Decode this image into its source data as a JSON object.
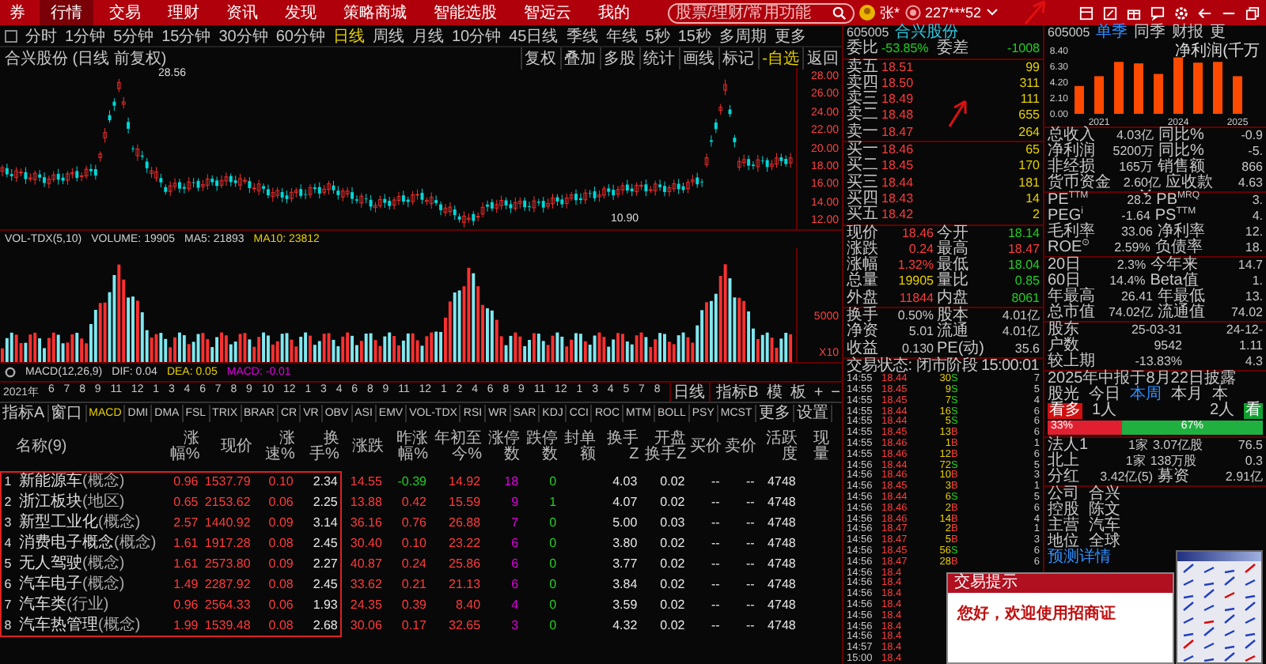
{
  "top_bar": {
    "logo": "券",
    "tabs": [
      {
        "label": "行情",
        "selected": true
      },
      {
        "label": "交易",
        "selected": false
      },
      {
        "label": "理财",
        "selected": false
      },
      {
        "label": "资讯",
        "selected": false
      },
      {
        "label": "发现",
        "selected": false
      },
      {
        "label": "策略商城",
        "selected": false
      },
      {
        "label": "智能选股",
        "selected": false
      },
      {
        "label": "智远云",
        "selected": false
      },
      {
        "label": "我的",
        "selected": false
      }
    ],
    "search": {
      "placeholder": "股票/理财/常用功能"
    },
    "user": "张*",
    "account": "227***52"
  },
  "toolbar": {
    "periods": [
      {
        "label": "分时",
        "selected": false
      },
      {
        "label": "1分钟",
        "selected": false
      },
      {
        "label": "5分钟",
        "selected": false
      },
      {
        "label": "15分钟",
        "selected": false
      },
      {
        "label": "30分钟",
        "selected": false
      },
      {
        "label": "60分钟",
        "selected": false
      },
      {
        "label": "日线",
        "selected": true
      },
      {
        "label": "周线",
        "selected": false
      },
      {
        "label": "月线",
        "selected": false
      },
      {
        "label": "10分钟",
        "selected": false
      },
      {
        "label": "45日线",
        "selected": false
      },
      {
        "label": "季线",
        "selected": false
      },
      {
        "label": "年线",
        "selected": false
      },
      {
        "label": "5秒",
        "selected": false
      },
      {
        "label": "15秒",
        "selected": false
      },
      {
        "label": "多周期",
        "selected": false
      },
      {
        "label": "更多",
        "selected": false
      }
    ]
  },
  "chart": {
    "title": "合兴股份 (日线 前复权)",
    "tools": [
      {
        "label": "复权",
        "selected": false
      },
      {
        "label": "叠加",
        "selected": false
      },
      {
        "label": "多股",
        "selected": false
      },
      {
        "label": "统计",
        "selected": false
      },
      {
        "label": "画线",
        "selected": false
      },
      {
        "label": "标记",
        "selected": false
      },
      {
        "label": "-自选",
        "selected": true
      },
      {
        "label": "返回",
        "selected": false
      }
    ],
    "y_labels": [
      "28.00",
      "26.00",
      "24.00",
      "22.00",
      "20.00",
      "18.00",
      "16.00",
      "14.00",
      "12.00"
    ],
    "high_label": "28.56",
    "low_label": "10.90"
  },
  "volume": {
    "legend": [
      {
        "text": "VOL-TDX(5,10)",
        "color": "#d0d0d0"
      },
      {
        "text": "VOLUME: 19905",
        "color": "#d0d0d0"
      },
      {
        "text": "MA5: 21893",
        "color": "#d0d0d0"
      },
      {
        "text": "MA10: 23812",
        "color": "#e8d000"
      }
    ],
    "y_labels": [
      "5000",
      "X10"
    ]
  },
  "macd": {
    "legend": [
      {
        "text": "MACD(12,26,9)",
        "color": "#d0d0d0"
      },
      {
        "text": "DIF: 0.04",
        "color": "#d0d0d0"
      },
      {
        "text": "DEA: 0.05",
        "color": "#e8d000"
      },
      {
        "text": "MACD: -0.01",
        "color": "#e000e0"
      }
    ]
  },
  "date_axis": {
    "labels": [
      "2021年",
      "6",
      "7",
      "8",
      "9",
      "11",
      "12",
      "1",
      "3",
      "4",
      "6",
      "7",
      "8",
      "9",
      "10",
      "12",
      "1",
      "3",
      "4",
      "6",
      "8",
      "9",
      "11",
      "12",
      "1",
      "2",
      "4",
      "6",
      "8",
      "9",
      "11",
      "12",
      "1",
      "3",
      "4",
      "5",
      "7",
      "8"
    ],
    "period": "日线",
    "controls": [
      "指标B",
      "模",
      "板",
      "+",
      "−"
    ]
  },
  "indicators": [
    {
      "label": "指标A",
      "selected": false
    },
    {
      "label": "窗口",
      "selected": false
    },
    {
      "label": "MACD",
      "selected": true
    },
    {
      "label": "DMI",
      "selected": false
    },
    {
      "label": "DMA",
      "selected": false
    },
    {
      "label": "FSL",
      "selected": false
    },
    {
      "label": "TRIX",
      "selected": false
    },
    {
      "label": "BRAR",
      "selected": false
    },
    {
      "label": "CR",
      "selected": false
    },
    {
      "label": "VR",
      "selected": false
    },
    {
      "label": "OBV",
      "selected": false
    },
    {
      "label": "ASI",
      "selected": false
    },
    {
      "label": "EMV",
      "selected": false
    },
    {
      "label": "VOL-TDX",
      "selected": false
    },
    {
      "label": "RSI",
      "selected": false
    },
    {
      "label": "WR",
      "selected": false
    },
    {
      "label": "SAR",
      "selected": false
    },
    {
      "label": "KDJ",
      "selected": false
    },
    {
      "label": "CCI",
      "selected": false
    },
    {
      "label": "ROC",
      "selected": false
    },
    {
      "label": "MTM",
      "selected": false
    },
    {
      "label": "BOLL",
      "selected": false
    },
    {
      "label": "PSY",
      "selected": false
    },
    {
      "label": "MCST",
      "selected": false
    },
    {
      "label": "更多",
      "selected": false
    },
    {
      "label": "设置",
      "selected": false
    }
  ],
  "table": {
    "columns": [
      "名称(9)",
      "涨幅%",
      "现价",
      "涨速%",
      "换手%",
      "涨跌",
      "昨涨幅%",
      "年初至今%",
      "涨停数",
      "跌停数",
      "封单额",
      "换手Z",
      "开盘换手Z",
      "买价",
      "卖价",
      "活跃度",
      "现量"
    ],
    "rows": [
      {
        "rank": "1",
        "tag": "(概念)",
        "cells": [
          "新能源车",
          "0.96",
          "1537.79",
          "0.10",
          "2.34",
          "14.55",
          "-0.39",
          "14.92",
          "18",
          "0",
          "",
          "4.03",
          "0.02",
          "--",
          "--",
          "4748"
        ]
      },
      {
        "rank": "2",
        "tag": "(地区)",
        "cells": [
          "浙江板块",
          "0.65",
          "2153.62",
          "0.06",
          "2.25",
          "13.88",
          "0.42",
          "15.59",
          "9",
          "1",
          "",
          "4.07",
          "0.02",
          "--",
          "--",
          "4748"
        ]
      },
      {
        "rank": "3",
        "tag": "(概念)",
        "cells": [
          "新型工业化",
          "2.57",
          "1440.92",
          "0.09",
          "3.14",
          "36.16",
          "0.76",
          "26.88",
          "7",
          "0",
          "",
          "5.00",
          "0.03",
          "--",
          "--",
          "4748"
        ]
      },
      {
        "rank": "4",
        "tag": "(概念)",
        "cells": [
          "消费电子概念",
          "1.61",
          "1917.28",
          "0.08",
          "2.45",
          "30.40",
          "0.10",
          "23.22",
          "6",
          "0",
          "",
          "3.80",
          "0.02",
          "--",
          "--",
          "4748"
        ]
      },
      {
        "rank": "5",
        "tag": "(概念)",
        "cells": [
          "无人驾驶",
          "1.61",
          "2573.80",
          "0.09",
          "2.27",
          "40.87",
          "0.24",
          "25.86",
          "6",
          "0",
          "",
          "3.77",
          "0.02",
          "--",
          "--",
          "4748"
        ]
      },
      {
        "rank": "6",
        "tag": "(概念)",
        "cells": [
          "汽车电子",
          "1.49",
          "2287.92",
          "0.08",
          "2.45",
          "33.62",
          "0.21",
          "21.13",
          "6",
          "0",
          "",
          "3.84",
          "0.02",
          "--",
          "--",
          "4748"
        ]
      },
      {
        "rank": "7",
        "tag": "(行业)",
        "cells": [
          "汽车类",
          "0.96",
          "2564.33",
          "0.06",
          "1.93",
          "24.35",
          "0.39",
          "8.40",
          "4",
          "0",
          "",
          "3.59",
          "0.02",
          "--",
          "--",
          "4748"
        ]
      },
      {
        "rank": "8",
        "tag": "(概念)",
        "cells": [
          "汽车热管理",
          "1.99",
          "1539.48",
          "0.08",
          "2.68",
          "30.06",
          "0.17",
          "32.65",
          "3",
          "0",
          "",
          "4.32",
          "0.02",
          "--",
          "--",
          "4748"
        ]
      }
    ]
  },
  "quote": {
    "code": "605005",
    "name": "合兴股份",
    "ratio_label": "委比",
    "ratio": "-53.85%",
    "diff_label": "委差",
    "diff": "-1008",
    "asks": [
      {
        "label": "卖五",
        "price": "18.51",
        "volume": "99"
      },
      {
        "label": "卖四",
        "price": "18.50",
        "volume": "311"
      },
      {
        "label": "卖三",
        "price": "18.49",
        "volume": "111"
      },
      {
        "label": "卖二",
        "price": "18.48",
        "volume": "655"
      },
      {
        "label": "卖一",
        "price": "18.47",
        "volume": "264"
      }
    ],
    "bids": [
      {
        "label": "买一",
        "price": "18.46",
        "volume": "65"
      },
      {
        "label": "买二",
        "price": "18.45",
        "volume": "170"
      },
      {
        "label": "买三",
        "price": "18.44",
        "volume": "181"
      },
      {
        "label": "买四",
        "price": "18.43",
        "volume": "14"
      },
      {
        "label": "买五",
        "price": "18.42",
        "volume": "2"
      }
    ],
    "stats": [
      [
        {
          "label": "现价",
          "value": "18.46",
          "color": "#ff3b3b"
        },
        {
          "label": "今开",
          "value": "18.14",
          "color": "#20d020"
        }
      ],
      [
        {
          "label": "涨跌",
          "value": "0.24",
          "color": "#ff3b3b"
        },
        {
          "label": "最高",
          "value": "18.47",
          "color": "#ff3b3b"
        }
      ],
      [
        {
          "label": "涨幅",
          "value": "1.32%",
          "color": "#ff3b3b"
        },
        {
          "label": "最低",
          "value": "18.04",
          "color": "#20d020"
        }
      ],
      [
        {
          "label": "总量",
          "value": "19905",
          "color": "#e8d000"
        },
        {
          "label": "量比",
          "value": "0.85",
          "color": "#20d020"
        }
      ],
      [
        {
          "label": "外盘",
          "value": "11844",
          "color": "#ff3b3b"
        },
        {
          "label": "内盘",
          "value": "8061",
          "color": "#20d020"
        }
      ]
    ],
    "info": [
      [
        {
          "label": "换手",
          "value": "0.50%"
        },
        {
          "label": "股本",
          "value": "4.01亿"
        }
      ],
      [
        {
          "label": "净资",
          "value": "5.01"
        },
        {
          "label": "流通",
          "value": "4.01亿"
        }
      ],
      [
        {
          "label": "收益",
          "value": "0.130"
        },
        {
          "label": "PE(动)",
          "value": "35.6"
        }
      ]
    ],
    "status": "交易状态: 闭市阶段 15:00:01",
    "ticks": [
      {
        "time": "14:55",
        "price": "18.44",
        "volume": "30",
        "side": "S",
        "kind": "sell",
        "count": "7"
      },
      {
        "time": "14:55",
        "price": "18.45",
        "volume": "9",
        "side": "S",
        "kind": "sell",
        "count": "5"
      },
      {
        "time": "14:55",
        "price": "18.45",
        "volume": "7",
        "side": "S",
        "kind": "sell",
        "count": "4"
      },
      {
        "time": "14:55",
        "price": "18.44",
        "volume": "16",
        "side": "S",
        "kind": "sell",
        "count": "6"
      },
      {
        "time": "14:55",
        "price": "18.44",
        "volume": "5",
        "side": "S",
        "kind": "sell",
        "count": "6"
      },
      {
        "time": "14:55",
        "price": "18.45",
        "volume": "13",
        "side": "B",
        "kind": "buy",
        "count": "6"
      },
      {
        "time": "14:55",
        "price": "18.46",
        "volume": "1",
        "side": "B",
        "kind": "buy",
        "count": "1"
      },
      {
        "time": "14:55",
        "price": "18.46",
        "volume": "12",
        "side": "B",
        "kind": "buy",
        "count": "6"
      },
      {
        "time": "14:56",
        "price": "18.44",
        "volume": "72",
        "side": "S",
        "kind": "sell",
        "count": "5"
      },
      {
        "time": "14:56",
        "price": "18.46",
        "volume": "10",
        "side": "B",
        "kind": "buy",
        "count": "3"
      },
      {
        "time": "14:56",
        "price": "18.45",
        "volume": "3",
        "side": "B",
        "kind": "buy",
        "count": "1"
      },
      {
        "time": "14:56",
        "price": "18.44",
        "volume": "6",
        "side": "S",
        "kind": "sell",
        "count": "5"
      },
      {
        "time": "14:56",
        "price": "18.46",
        "volume": "2",
        "side": "B",
        "kind": "buy",
        "count": "6"
      },
      {
        "time": "14:56",
        "price": "18.46",
        "volume": "14",
        "side": "B",
        "kind": "buy",
        "count": "4"
      },
      {
        "time": "14:56",
        "price": "18.47",
        "volume": "2",
        "side": "B",
        "kind": "buy",
        "count": "1"
      },
      {
        "time": "14:56",
        "price": "18.47",
        "volume": "5",
        "side": "B",
        "kind": "buy",
        "count": "3"
      },
      {
        "time": "14:56",
        "price": "18.45",
        "volume": "56",
        "side": "S",
        "kind": "sell",
        "count": "6"
      },
      {
        "time": "14:56",
        "price": "18.47",
        "volume": "28",
        "side": "B",
        "kind": "buy",
        "count": "6"
      },
      {
        "time": "14:56",
        "price": "18.4"
      },
      {
        "time": "14:56",
        "price": "18.4"
      },
      {
        "time": "14:56",
        "price": "18.4"
      },
      {
        "time": "14:56",
        "price": "18.4"
      },
      {
        "time": "14:56",
        "price": "18.4"
      },
      {
        "time": "14:56",
        "price": "18.4"
      },
      {
        "time": "14:56",
        "price": "18.4"
      },
      {
        "time": "14:57",
        "price": "18.4"
      },
      {
        "time": "15:00",
        "price": "18.4"
      }
    ]
  },
  "fundamentals": {
    "code": "605005",
    "tabs": [
      {
        "label": "单季",
        "selected": true
      },
      {
        "label": "同季",
        "selected": false
      },
      {
        "label": "财报",
        "selected": false
      },
      {
        "label": "更",
        "selected": false
      }
    ],
    "chart_data": {
      "type": "bar",
      "title": "净利润(千万",
      "categories": [
        null,
        "2021",
        null,
        null,
        null,
        "2024",
        null,
        null,
        "2025"
      ],
      "yticks": [
        {
          "value": 0,
          "label": "0.00"
        },
        {
          "value": 2.1,
          "label": "2.10"
        },
        {
          "value": 4.2,
          "label": "4.20"
        },
        {
          "value": 6.3,
          "label": "6.30"
        },
        {
          "value": 8.4,
          "label": "8.40"
        }
      ],
      "ylim": [
        0,
        8.4
      ],
      "series": [
        {
          "color": "#ff4a00",
          "values": [
            3.7,
            5.0,
            6.9,
            6.7,
            5.3,
            7.5,
            6.8,
            6.9,
            5.0
          ]
        }
      ]
    },
    "finance": [
      [
        {
          "label": "总收入",
          "value": "4.03亿"
        },
        {
          "label": "同比%",
          "value": "-0.9"
        }
      ],
      [
        {
          "label": "净利润",
          "value": "5200万"
        },
        {
          "label": "同比%",
          "value": "-5."
        }
      ],
      [
        {
          "label": "非经损",
          "value": "165万"
        },
        {
          "label": "销售额",
          "value": "866"
        }
      ],
      [
        {
          "label": "货币资金",
          "value": "2.60亿"
        },
        {
          "label": "应收款",
          "value": "4.63"
        }
      ]
    ],
    "valuation": [
      [
        {
          "label": "PE$^{TTM}$",
          "value": "28.2"
        },
        {
          "label": "PB$^{MRQ}$",
          "value": "3."
        }
      ],
      [
        {
          "label": "PEG$^{i}$",
          "value": "-1.64"
        },
        {
          "label": "PS$^{TTM}$",
          "value": "4."
        }
      ],
      [
        {
          "label": "毛利率",
          "value": "33.06"
        },
        {
          "label": "净利率",
          "value": "12."
        }
      ],
      [
        {
          "label": "ROE$^{⊙}$",
          "value": "2.59%"
        },
        {
          "label": "负债率",
          "value": "18."
        }
      ]
    ],
    "performance": [
      [
        {
          "label": "20日",
          "value": "2.3%"
        },
        {
          "label": "今年来",
          "value": "14.7"
        }
      ],
      [
        {
          "label": "60日",
          "value": "14.4%"
        },
        {
          "label": "Beta值",
          "value": "1."
        }
      ],
      [
        {
          "label": "年最高",
          "value": "26.41"
        },
        {
          "label": "年最低",
          "value": "13."
        }
      ],
      [
        {
          "label": "总市值",
          "value": "74.02亿"
        },
        {
          "label": "流通值",
          "value": "74.02"
        }
      ]
    ],
    "holders": [
      [
        "股东",
        "25-03-31",
        "24-12-"
      ],
      [
        "户数",
        "9542",
        "1.11"
      ],
      [
        "较上期",
        "-13.83%",
        "4.3"
      ]
    ],
    "report_notice": "2025年中报于8月22日披露",
    "sentiment": {
      "label": "股光",
      "periods": [
        {
          "label": "今日",
          "selected": false
        },
        {
          "label": "本周",
          "selected": true
        },
        {
          "label": "本月",
          "selected": false
        },
        {
          "label": "本",
          "selected": false
        }
      ],
      "bull_badge": "看多",
      "bull_count": "1人",
      "bear_count": "2人",
      "bear_badge": "看",
      "level": 0.33,
      "bull_pct": "33%",
      "bear_pct": "67%"
    },
    "holdings": [
      [
        "法人1",
        "1家",
        "3.07亿股",
        "76.5"
      ],
      [
        "北上",
        "1家",
        "138万股",
        "0.3"
      ]
    ],
    "dividend": {
      "label": "分红",
      "value": "3.42亿(5)",
      "raise_label": "募资",
      "raise": "2.91亿"
    },
    "profile": [
      [
        "公司",
        "合兴"
      ],
      [
        "控股",
        "陈文"
      ],
      [
        "主营",
        "汽车"
      ],
      [
        "地位",
        "全球"
      ]
    ],
    "forecast_link": "预测详情"
  },
  "dialog": {
    "title": "交易提示",
    "greeting": "您好，欢迎使用招商证"
  }
}
